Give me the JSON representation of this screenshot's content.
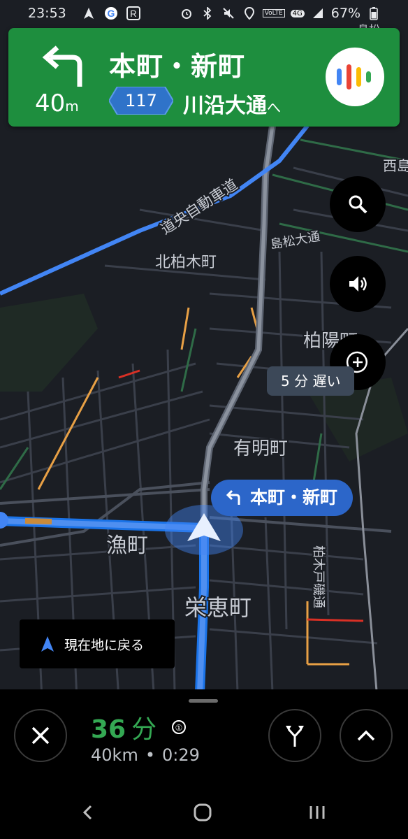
{
  "status_bar": {
    "time": "23:53",
    "network": "4G",
    "volte": "VoLTE",
    "battery": "67%"
  },
  "direction": {
    "distance_value": "40",
    "distance_unit": "m",
    "street": "本町・新町",
    "route_number": "117",
    "toward_road": "川沿大通",
    "toward_suffix": "へ"
  },
  "map_labels": {
    "expressway": "道央自動車道",
    "kita_kashiwagi": "北柏木町",
    "shimamatsu": "島松大通",
    "hakuyo": "柏陽町",
    "ariake": "有明町",
    "izari": "漁町",
    "sakaemachi": "栄恵町",
    "kashiwagi_dori": "柏木戸磯通",
    "nishi_edge": "西島",
    "top_edge": "島松"
  },
  "delay_badge": "5 分 遅い",
  "turn_pill": "本町・新町",
  "recenter_label": "現在地に戻る",
  "trip": {
    "eta_minutes": "36",
    "eta_unit": "分",
    "distance": "40km",
    "arrival": "0:29"
  },
  "colors": {
    "banner_green": "#1e8e3e",
    "route_blue": "#4285f4",
    "eta_green": "#34a853",
    "traffic_orange": "#e8a045",
    "traffic_red": "#d93025"
  },
  "icons": [
    "turn-left-icon",
    "assistant-icon",
    "search-icon",
    "volume-icon",
    "add-report-icon",
    "navigation-arrow-icon",
    "close-icon",
    "alternate-routes-icon",
    "chevron-up-icon",
    "eco-icon",
    "back-icon",
    "home-icon",
    "recents-icon"
  ]
}
